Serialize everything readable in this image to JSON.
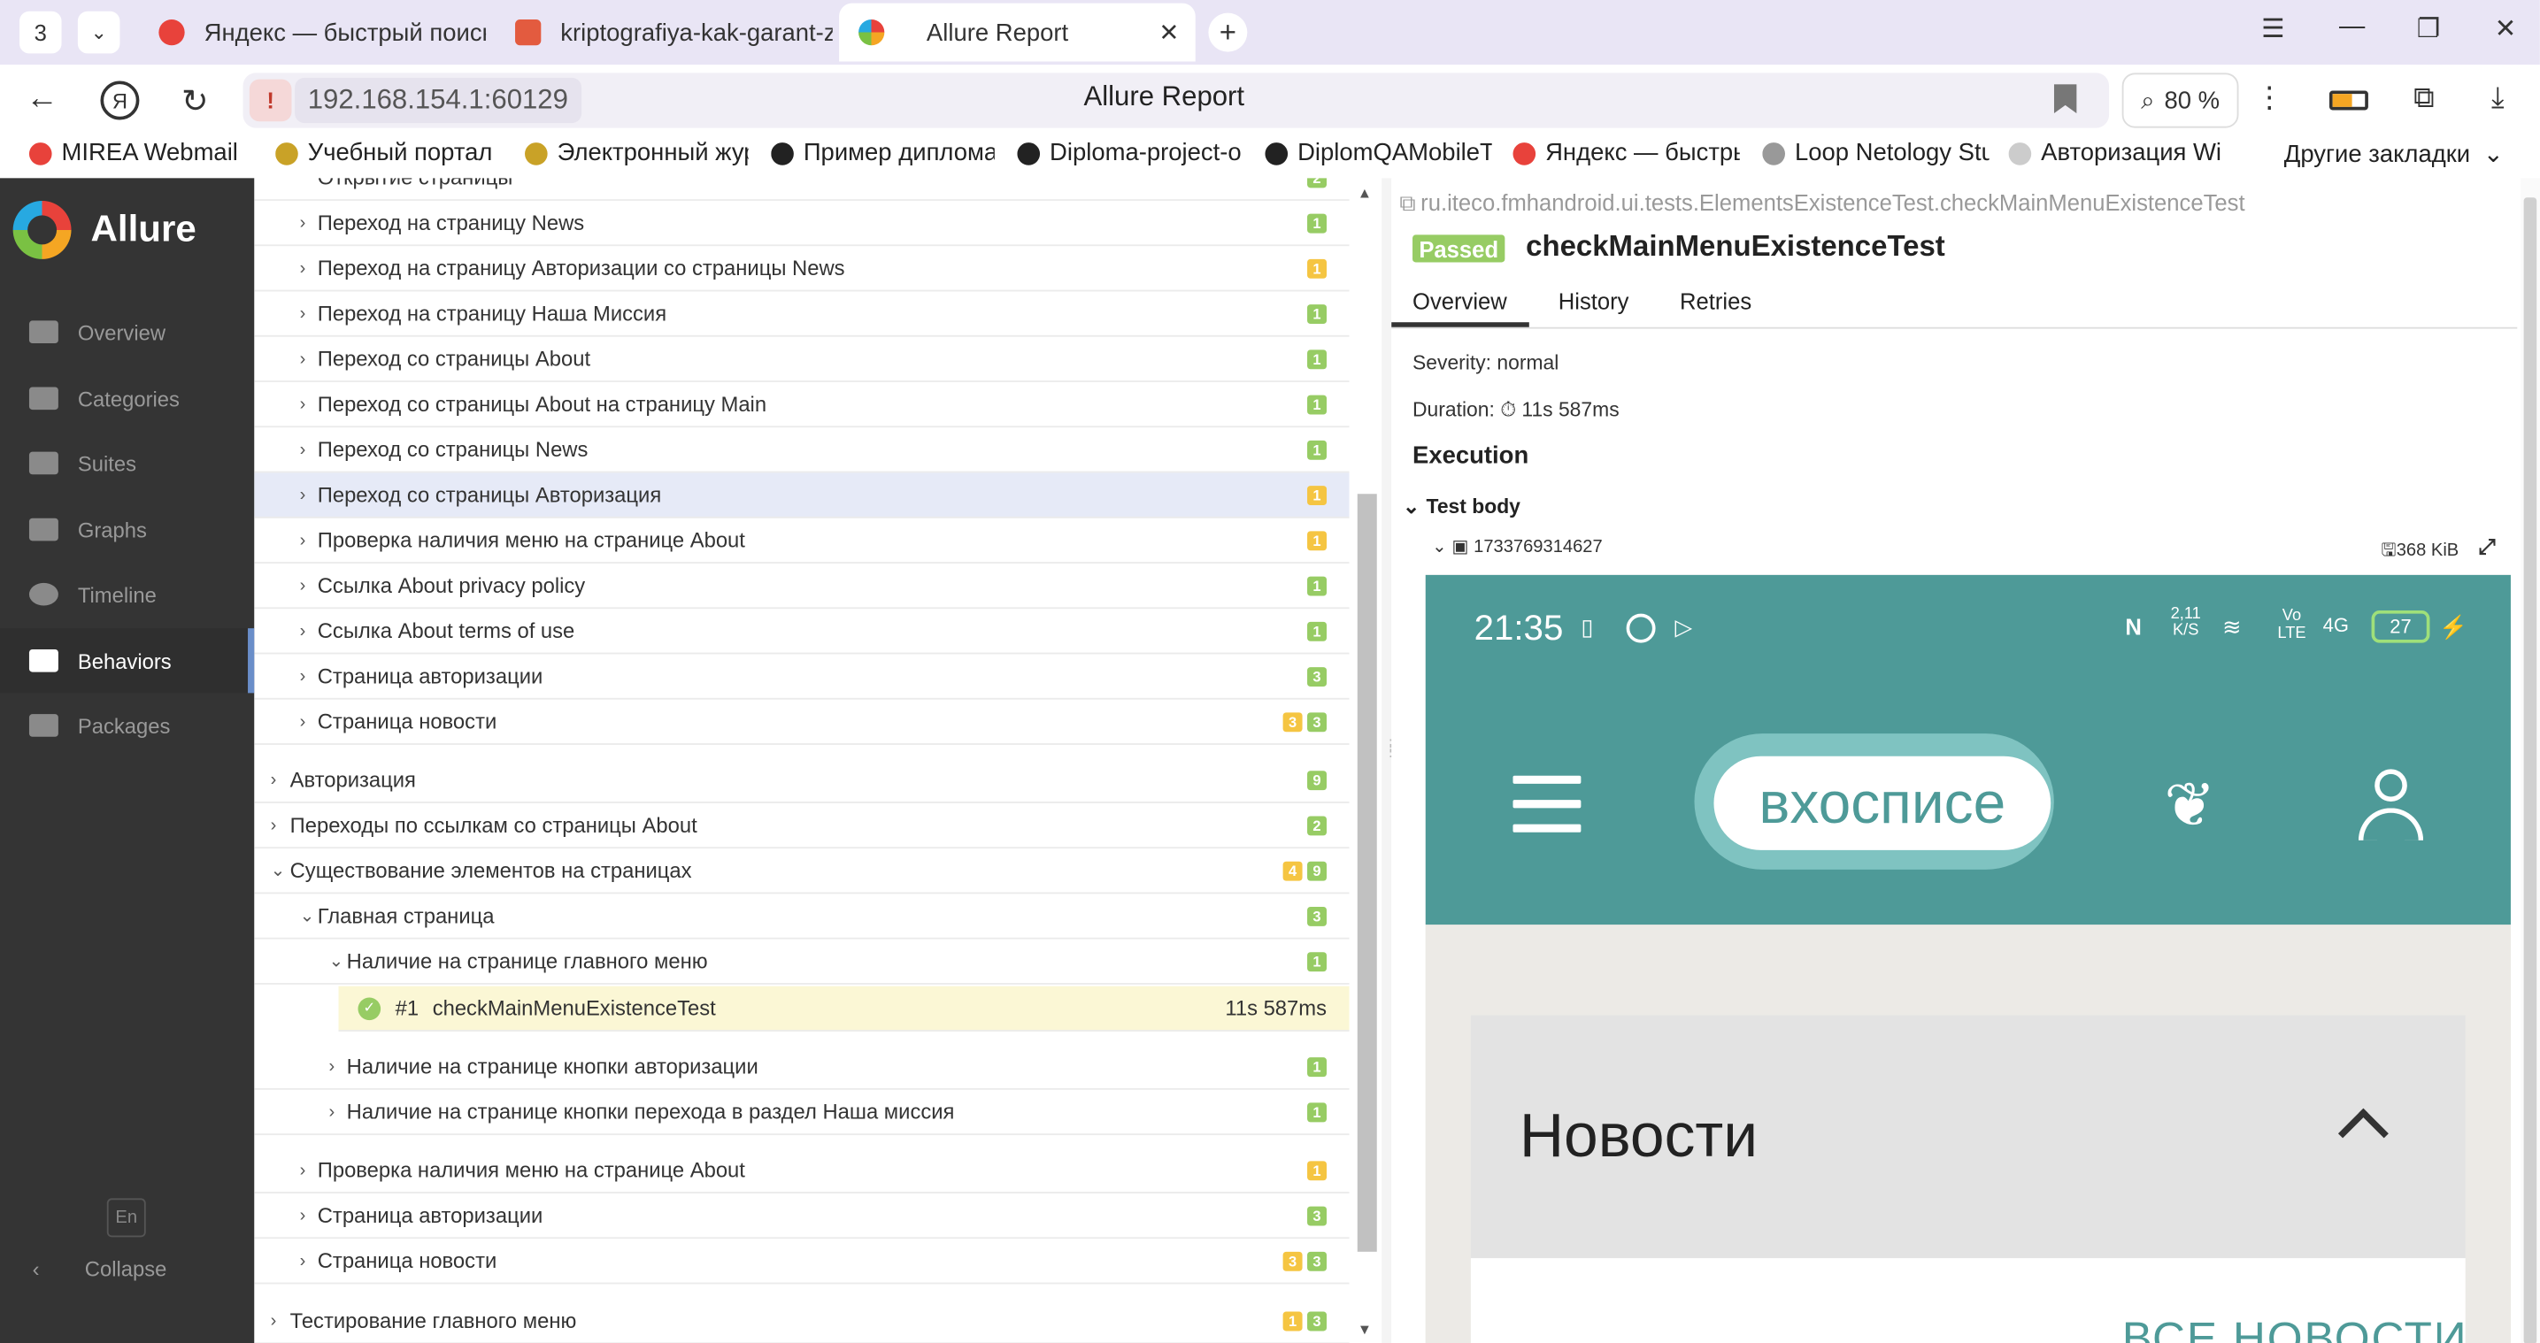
{
  "browser": {
    "tab_count": "3",
    "tabs": [
      {
        "title": "Яндекс — быстрый поиск",
        "color": "#e8423b"
      },
      {
        "title": "kriptografiya-kak-garant-z",
        "color": "#e35b3f"
      },
      {
        "title": "Allure Report",
        "color": "#7ac143",
        "active": true
      }
    ],
    "url": "192.168.154.1:60129",
    "page_title": "Allure Report",
    "zoom": "80 %",
    "bookmarks": [
      {
        "label": "MIREA Webmail ::",
        "color": "#e8423b"
      },
      {
        "label": "Учебный портал Р",
        "color": "#c9a227"
      },
      {
        "label": "Электронный жур",
        "color": "#c9a227"
      },
      {
        "label": "Пример диплома",
        "color": "#222222"
      },
      {
        "label": "Diploma-project-o",
        "color": "#222222"
      },
      {
        "label": "DiplomQAMobileT",
        "color": "#222222"
      },
      {
        "label": "Яндекс — быстры",
        "color": "#e8423b"
      },
      {
        "label": "Loop Netology Stu",
        "color": "#999999"
      },
      {
        "label": "Авторизация Wi",
        "color": "#cccccc"
      }
    ],
    "other_bookmarks": "Другие закладки"
  },
  "sidebar": {
    "brand": "Allure",
    "items": [
      {
        "label": "Overview",
        "icon": "home-icon"
      },
      {
        "label": "Categories",
        "icon": "flag-icon"
      },
      {
        "label": "Suites",
        "icon": "briefcase-icon"
      },
      {
        "label": "Graphs",
        "icon": "bar-chart-icon"
      },
      {
        "label": "Timeline",
        "icon": "clock-icon"
      },
      {
        "label": "Behaviors",
        "icon": "list-icon",
        "active": true
      },
      {
        "label": "Packages",
        "icon": "packages-icon"
      }
    ],
    "lang": "En",
    "collapse": "Collapse"
  },
  "tree": {
    "rows": [
      {
        "label": "Открытие страницы",
        "badges": [
          {
            "v": "2",
            "c": "g"
          }
        ]
      },
      {
        "label": "Переход на страницу News",
        "badges": [
          {
            "v": "1",
            "c": "g"
          }
        ]
      },
      {
        "label": "Переход на страницу Авторизации со страницы News",
        "badges": [
          {
            "v": "1",
            "c": "y"
          }
        ]
      },
      {
        "label": "Переход на страницу Наша Миссия",
        "badges": [
          {
            "v": "1",
            "c": "g"
          }
        ]
      },
      {
        "label": "Переход со страницы About",
        "badges": [
          {
            "v": "1",
            "c": "g"
          }
        ]
      },
      {
        "label": "Переход со страницы About на страницу Main",
        "badges": [
          {
            "v": "1",
            "c": "g"
          }
        ]
      },
      {
        "label": "Переход со страницы News",
        "badges": [
          {
            "v": "1",
            "c": "g"
          }
        ]
      },
      {
        "label": "Переход со страницы Авторизация",
        "badges": [
          {
            "v": "1",
            "c": "y"
          }
        ]
      },
      {
        "label": "Проверка наличия меню на странице About",
        "badges": [
          {
            "v": "1",
            "c": "y"
          }
        ]
      },
      {
        "label": "Ссылка About privacy policy",
        "badges": [
          {
            "v": "1",
            "c": "g"
          }
        ]
      },
      {
        "label": "Ссылка About terms of use",
        "badges": [
          {
            "v": "1",
            "c": "g"
          }
        ]
      },
      {
        "label": "Страница авторизации",
        "badges": [
          {
            "v": "3",
            "c": "g"
          }
        ]
      },
      {
        "label": "Страница новости",
        "badges": [
          {
            "v": "3",
            "c": "y"
          },
          {
            "v": "3",
            "c": "g"
          }
        ]
      },
      {
        "label": "Авторизация",
        "badges": [
          {
            "v": "9",
            "c": "g"
          }
        ]
      },
      {
        "label": "Переходы по ссылкам со страницы About",
        "badges": [
          {
            "v": "2",
            "c": "g"
          }
        ]
      },
      {
        "label": "Существование элементов на страницах",
        "badges": [
          {
            "v": "4",
            "c": "y"
          },
          {
            "v": "9",
            "c": "g"
          }
        ]
      },
      {
        "label": "Главная страница",
        "badges": [
          {
            "v": "3",
            "c": "g"
          }
        ]
      },
      {
        "label": "Наличие на странице главного меню",
        "badges": [
          {
            "v": "1",
            "c": "g"
          }
        ]
      },
      {
        "label": "Наличие на странице кнопки авторизации",
        "badges": [
          {
            "v": "1",
            "c": "g"
          }
        ]
      },
      {
        "label": "Наличие на странице кнопки перехода в раздел Наша миссия",
        "badges": [
          {
            "v": "1",
            "c": "g"
          }
        ]
      },
      {
        "label": "Проверка наличия меню на странице About",
        "badges": [
          {
            "v": "1",
            "c": "y"
          }
        ]
      },
      {
        "label": "Страница авторизации",
        "badges": [
          {
            "v": "3",
            "c": "g"
          }
        ]
      },
      {
        "label": "Страница новости",
        "badges": [
          {
            "v": "3",
            "c": "y"
          },
          {
            "v": "3",
            "c": "g"
          }
        ]
      },
      {
        "label": "Тестирование главного меню",
        "badges": [
          {
            "v": "1",
            "c": "y"
          },
          {
            "v": "3",
            "c": "g"
          }
        ]
      }
    ],
    "case": {
      "num": "#1",
      "name": "checkMainMenuExistenceTest",
      "duration": "11s 587ms"
    }
  },
  "detail": {
    "full_name": "ru.iteco.fmhandroid.ui.tests.ElementsExistenceTest.checkMainMenuExistenceTest",
    "status": "Passed",
    "name": "checkMainMenuExistenceTest",
    "tabs": [
      "Overview",
      "History",
      "Retries"
    ],
    "severity": "Severity: normal",
    "duration": "Duration: ⏱ 11s 587ms",
    "execution": "Execution",
    "test_body": "Test body",
    "attachment": "1733769314627",
    "attachment_size": "368 KiB"
  },
  "phone": {
    "time": "21:35",
    "signal": "2,11",
    "signal_unit": "K/S",
    "volte": "Vo",
    "volte_sub": "LTE",
    "net": "4G",
    "battery": "27",
    "logo": "вхосписе",
    "news": "Новости",
    "all_news": "ВСЕ НОВОСТИ"
  }
}
